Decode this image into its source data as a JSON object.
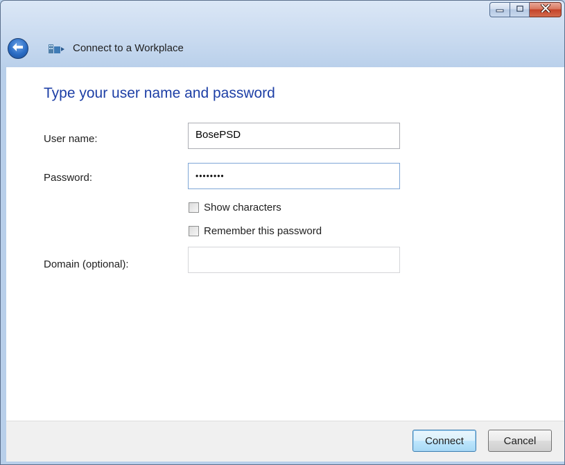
{
  "window": {
    "title": "Connect to a Workplace"
  },
  "main": {
    "heading": "Type your user name and password",
    "username": {
      "label": "User name:",
      "value": "BosePSD"
    },
    "password": {
      "label": "Password:",
      "value": "••••••••"
    },
    "show_characters": {
      "label": "Show characters",
      "checked": false
    },
    "remember_password": {
      "label": "Remember this password",
      "checked": false
    },
    "domain": {
      "label": "Domain (optional):",
      "value": ""
    }
  },
  "footer": {
    "connect_label": "Connect",
    "cancel_label": "Cancel"
  },
  "icons": {
    "back": "back-arrow-icon",
    "app": "workplace-connection-icon",
    "minimize": "minimize-icon",
    "maximize": "maximize-icon",
    "close": "close-icon"
  },
  "colors": {
    "heading": "#1d3fa6",
    "accent": "#2a6cc4",
    "close": "#c4432a"
  }
}
